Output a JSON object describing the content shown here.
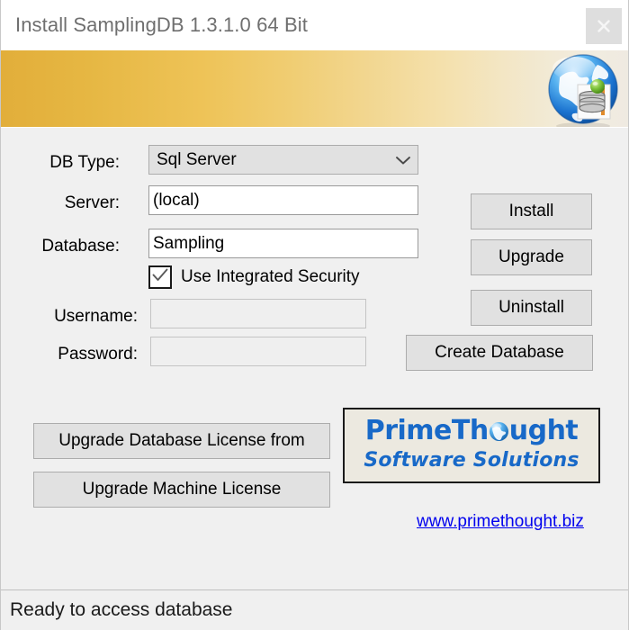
{
  "window": {
    "title": "Install SamplingDB 1.3.1.0 64 Bit",
    "close_icon": "close-icon"
  },
  "banner": {
    "icon": "globe-database-icon",
    "gradient_start": "#e2ae3a",
    "gradient_end": "#efeae1"
  },
  "form": {
    "db_type": {
      "label": "DB Type:",
      "value": "Sql Server",
      "arrow_icon": "chevron-down-icon"
    },
    "server": {
      "label": "Server:",
      "value": "(local)",
      "placeholder": ""
    },
    "database": {
      "label": "Database:",
      "value": "Sampling",
      "placeholder": ""
    },
    "integrated_security": {
      "label": "Use Integrated Security",
      "checked": true,
      "check_icon": "checkmark-icon"
    },
    "username": {
      "label": "Username:",
      "value": "",
      "placeholder": ""
    },
    "password": {
      "label": "Password:",
      "value": "",
      "placeholder": ""
    }
  },
  "actions": {
    "install": "Install",
    "upgrade": "Upgrade",
    "uninstall": "Uninstall",
    "create_database": "Create Database",
    "upgrade_db_license": "Upgrade Database License from",
    "upgrade_machine_license": "Upgrade Machine License"
  },
  "branding": {
    "logo_line1_pre": "PrimeTh",
    "logo_line1_post": "ught",
    "logo_line2": "Software Solutions",
    "logo_globe_icon": "globe-icon",
    "website": "www.primethought.biz",
    "link_color": "#0000ee",
    "brand_color": "#1869c8"
  },
  "status": {
    "message": "Ready to access database"
  }
}
